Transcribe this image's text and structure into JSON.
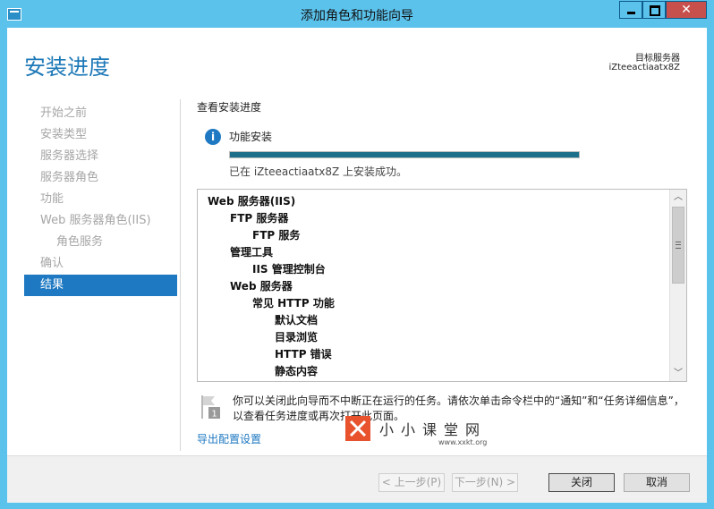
{
  "window": {
    "title": "添加角色和功能向导",
    "close_glyph": "✕"
  },
  "header": {
    "page_title": "安装进度",
    "target_label": "目标服务器",
    "target_name": "iZteeactiaatx8Z"
  },
  "nav": {
    "items": [
      "开始之前",
      "安装类型",
      "服务器选择",
      "服务器角色",
      "功能",
      "Web 服务器角色(IIS)",
      "角色服务",
      "确认",
      "结果"
    ]
  },
  "main": {
    "section_title": "查看安装进度",
    "feature_label": "功能安装",
    "progress_fraction": 1.0,
    "status_text": "已在 iZteeactiaatx8Z 上安装成功。",
    "tree": [
      {
        "text": "Web 服务器(IIS)",
        "level": 0
      },
      {
        "text": "FTP 服务器",
        "level": 1
      },
      {
        "text": "FTP 服务",
        "level": 2
      },
      {
        "text": "管理工具",
        "level": 1
      },
      {
        "text": "IIS 管理控制台",
        "level": 2
      },
      {
        "text": "Web 服务器",
        "level": 1
      },
      {
        "text": "常见 HTTP 功能",
        "level": 2
      },
      {
        "text": "默认文档",
        "level": 3
      },
      {
        "text": "目录浏览",
        "level": 3
      },
      {
        "text": "HTTP 错误",
        "level": 3
      },
      {
        "text": "静态内容",
        "level": 3
      }
    ],
    "notice": "你可以关闭此向导而不中断正在运行的任务。请依次单击命令栏中的“通知”和“任务详细信息”，以查看任务进度或再次打开此页面。",
    "export_link": "导出配置设置"
  },
  "watermark": {
    "name": "小小课堂网",
    "url": "www.xxkt.org",
    "brand_color": "#e8532d"
  },
  "footer": {
    "prev": "< 上一步(P)",
    "next": "下一步(N) >",
    "close": "关闭",
    "cancel": "取消"
  },
  "colors": {
    "accent": "#1e79c2",
    "titlebar": "#5bc2ec",
    "progress": "#1e6f8a"
  }
}
